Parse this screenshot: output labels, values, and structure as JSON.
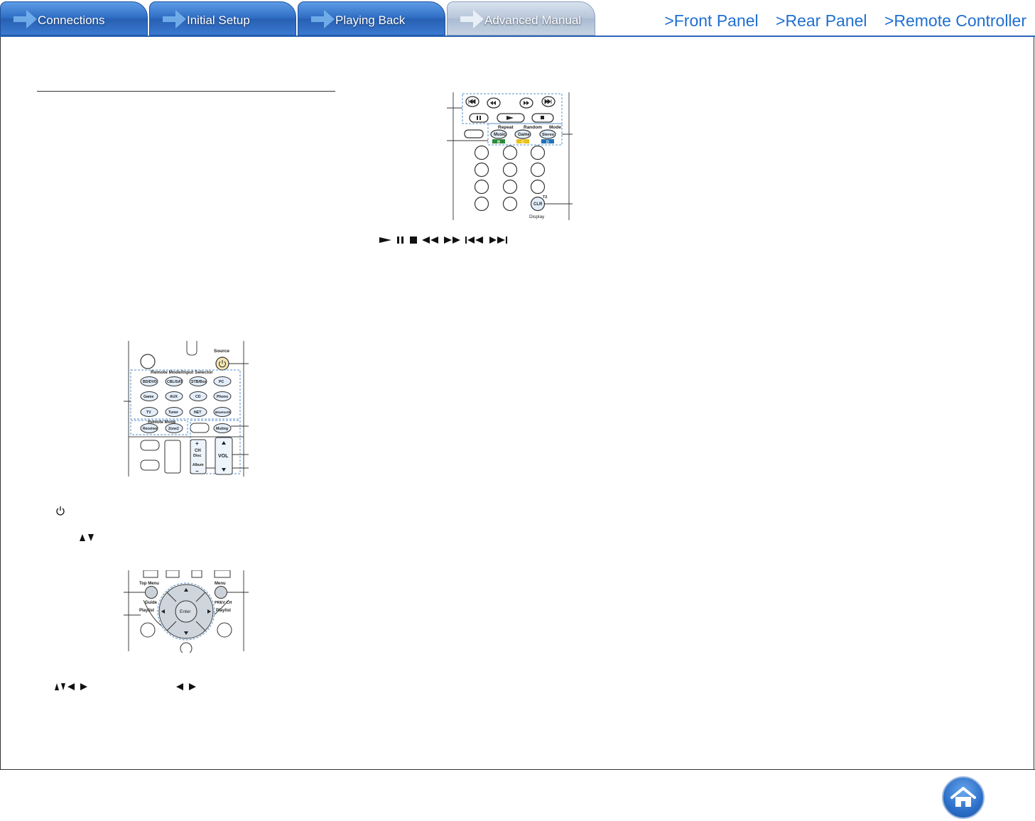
{
  "tabs": [
    {
      "label": "Connections",
      "active": false
    },
    {
      "label": "Initial Setup",
      "active": false
    },
    {
      "label": "Playing Back",
      "active": false
    },
    {
      "label": "Advanced Manual",
      "active": true
    }
  ],
  "top_links": [
    ">Front Panel",
    ">Rear Panel",
    ">Remote Controller"
  ],
  "remote_top": {
    "labels": {
      "repeat": "Repeat",
      "random": "Random",
      "mode": "Mode",
      "music": "Music",
      "game": "Game",
      "stereo": "Stereo",
      "b": "B",
      "c": "C",
      "d": "D",
      "t2": "T2",
      "clr": "CLR",
      "display": "Display"
    }
  },
  "remote_source": {
    "source": "Source",
    "selector_title": "Remote Mode/Input Selector",
    "buttons": [
      "BD/DVD",
      "CBL/SAT",
      "STB/Box",
      "PC",
      "Game",
      "AUX",
      "CD",
      "Phono",
      "TV",
      "Tuner",
      "NET",
      "Bluetooth"
    ],
    "remote_mode": "Remote Mode",
    "mode_buttons": [
      "Receiver",
      "Zone2"
    ],
    "muting": "Muting",
    "ch": "CH",
    "disc": "Disc",
    "album": "Album",
    "vol": "VOL"
  },
  "remote_nav": {
    "top_menu": "Top Menu",
    "guide": "Guide",
    "playlist_left": "Playlist",
    "enter": "Enter",
    "menu": "Menu",
    "prev_ch": "PREV CH",
    "playlist_right": "Playlist"
  },
  "colors": {
    "tab_blue": "#2f6dc4",
    "link_blue": "#1f6fd0",
    "key_b": "#2d8a3a",
    "key_c": "#e8c21a",
    "key_d": "#1f6fb5"
  }
}
